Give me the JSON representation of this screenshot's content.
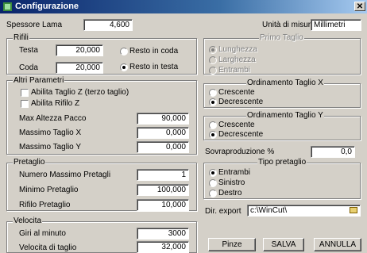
{
  "window": {
    "title": "Configurazione",
    "close_glyph": "✕"
  },
  "spessore_lama": {
    "label": "Spessore Lama",
    "value": "4,600"
  },
  "unita_misura": {
    "label": "Unità di misura",
    "value": "Millimetri"
  },
  "rifili": {
    "legend": "Rifili",
    "testa_label": "Testa",
    "testa_value": "20,000",
    "coda_label": "Coda",
    "coda_value": "20,000",
    "resto_coda": "Resto in coda",
    "resto_testa": "Resto in testa",
    "selected": "resto_testa"
  },
  "primo_taglio": {
    "legend": "Primo Taglio",
    "options": [
      "Lunghezza",
      "Larghezza",
      "Entrambi"
    ],
    "selected": 0,
    "disabled": true
  },
  "altri_parametri": {
    "legend": "Altri Parametri",
    "abilita_taglio_z": "Abilita Taglio Z (terzo taglio)",
    "abilita_rifilo_z": "Abilita Rifilo Z",
    "max_altezza_label": "Max Altezza Pacco",
    "max_altezza_value": "90,000",
    "massimo_x_label": "Massimo Taglio X",
    "massimo_x_value": "0,000",
    "massimo_y_label": "Massimo Taglio Y",
    "massimo_y_value": "0,000"
  },
  "ordinamento_x": {
    "legend": "Ordinamento Taglio X",
    "options": [
      "Crescente",
      "Decrescente"
    ],
    "selected": 1
  },
  "ordinamento_y": {
    "legend": "Ordinamento Taglio Y",
    "options": [
      "Crescente",
      "Decrescente"
    ],
    "selected": 1
  },
  "sovraproduzione": {
    "label": "Sovraproduzione %",
    "value": "0,0"
  },
  "pretaglio": {
    "legend": "Pretaglio",
    "numero_label": "Numero Massimo Pretagli",
    "numero_value": "1",
    "minimo_label": "Minimo Pretaglio",
    "minimo_value": "100,000",
    "rifilo_label": "Rifilo Pretaglio",
    "rifilo_value": "10,000"
  },
  "tipo_pretaglio": {
    "legend": "Tipo pretaglio",
    "options": [
      "Entrambi",
      "Sinistro",
      "Destro"
    ],
    "selected": 0
  },
  "dir_export": {
    "label": "Dir. export",
    "value": "c:\\WinCut\\"
  },
  "velocita": {
    "legend": "Velocita",
    "giri_label": "Giri al minuto",
    "giri_value": "3000",
    "velocita_label": "Velocita di taglio",
    "velocita_value": "32,000"
  },
  "buttons": {
    "pinze": "Pinze",
    "salva": "SALVA",
    "annulla": "ANNULLA"
  }
}
